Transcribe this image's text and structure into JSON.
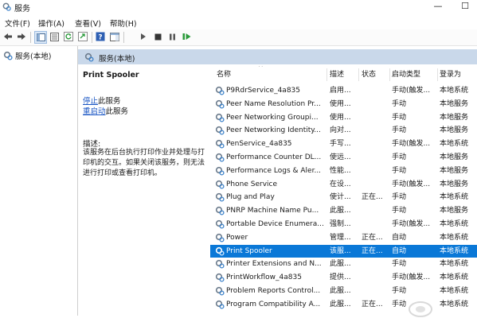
{
  "window": {
    "title": "服务"
  },
  "menu": [
    "文件(F)",
    "操作(A)",
    "查看(V)",
    "帮助(H)"
  ],
  "tree": {
    "root_label": "服务(本地)"
  },
  "pane": {
    "header_label": "服务(本地)"
  },
  "detail": {
    "service_name": "Print Spooler",
    "stop_link": "停止",
    "stop_suffix": "此服务",
    "restart_link": "重启动",
    "restart_suffix": "此服务",
    "desc_label": "描述:",
    "desc_text": "该服务在后台执行打印作业并处理与打印机的交互。如果关闭该服务，则无法进行打印或查看打印机。"
  },
  "table": {
    "columns": {
      "name": "名称",
      "desc": "描述",
      "status": "状态",
      "startup": "启动类型",
      "logon": "登录为"
    },
    "rows": [
      {
        "name": "P9RdrService_4a835",
        "desc": "启用...",
        "status": "",
        "startup": "手动(触发...",
        "logon": "本地系统"
      },
      {
        "name": "Peer Name Resolution Pr...",
        "desc": "使用...",
        "status": "",
        "startup": "手动",
        "logon": "本地服务"
      },
      {
        "name": "Peer Networking Groupi...",
        "desc": "使用...",
        "status": "",
        "startup": "手动",
        "logon": "本地服务"
      },
      {
        "name": "Peer Networking Identity...",
        "desc": "向对...",
        "status": "",
        "startup": "手动",
        "logon": "本地服务"
      },
      {
        "name": "PenService_4a835",
        "desc": "手写...",
        "status": "",
        "startup": "手动(触发...",
        "logon": "本地系统"
      },
      {
        "name": "Performance Counter DL...",
        "desc": "使远...",
        "status": "",
        "startup": "手动",
        "logon": "本地服务"
      },
      {
        "name": "Performance Logs & Aler...",
        "desc": "性能...",
        "status": "",
        "startup": "手动",
        "logon": "本地服务"
      },
      {
        "name": "Phone Service",
        "desc": "在设...",
        "status": "",
        "startup": "手动(触发...",
        "logon": "本地服务"
      },
      {
        "name": "Plug and Play",
        "desc": "使计...",
        "status": "正在...",
        "startup": "手动",
        "logon": "本地系统"
      },
      {
        "name": "PNRP Machine Name Pu...",
        "desc": "此服...",
        "status": "",
        "startup": "手动",
        "logon": "本地服务"
      },
      {
        "name": "Portable Device Enumera...",
        "desc": "强制...",
        "status": "",
        "startup": "手动(触发...",
        "logon": "本地系统"
      },
      {
        "name": "Power",
        "desc": "管理...",
        "status": "正在...",
        "startup": "自动",
        "logon": "本地系统"
      },
      {
        "name": "Print Spooler",
        "desc": "该服...",
        "status": "正在...",
        "startup": "自动",
        "logon": "本地系统"
      },
      {
        "name": "Printer Extensions and N...",
        "desc": "此服...",
        "status": "",
        "startup": "手动",
        "logon": "本地系统"
      },
      {
        "name": "PrintWorkflow_4a835",
        "desc": "提供...",
        "status": "",
        "startup": "手动(触发...",
        "logon": "本地系统"
      },
      {
        "name": "Problem Reports Control...",
        "desc": "此服...",
        "status": "",
        "startup": "手动",
        "logon": "本地系统"
      },
      {
        "name": "Program Compatibility A...",
        "desc": "此服...",
        "status": "正在...",
        "startup": "手动",
        "logon": "本地系统"
      }
    ],
    "selected_index": 12
  },
  "colors": {
    "selection": "#0a78d7",
    "pane_header": "#c9d8ea",
    "link": "#1a56c4"
  }
}
